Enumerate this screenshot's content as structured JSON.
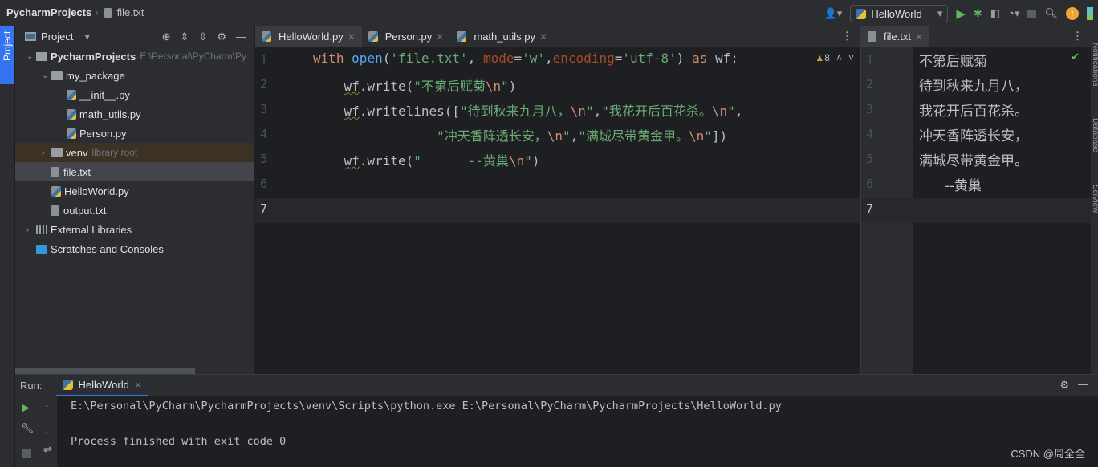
{
  "breadcrumb": {
    "project": "PycharmProjects",
    "file": "file.txt"
  },
  "toolbar": {
    "run_config": "HelloWorld"
  },
  "left_stripe": {
    "project_tab": "Project"
  },
  "project_panel": {
    "title": "Project",
    "items": [
      {
        "label": "PycharmProjects",
        "hint": "E:\\Personal\\PyCharm\\Py",
        "type": "folder",
        "indent": 0,
        "expanded": true
      },
      {
        "label": "my_package",
        "type": "package",
        "indent": 1,
        "expanded": true
      },
      {
        "label": "__init__.py",
        "type": "py",
        "indent": 2
      },
      {
        "label": "math_utils.py",
        "type": "py",
        "indent": 2
      },
      {
        "label": "Person.py",
        "type": "py",
        "indent": 2
      },
      {
        "label": "venv",
        "hint": "library root",
        "type": "folder",
        "indent": 1,
        "expanded": false
      },
      {
        "label": "file.txt",
        "type": "txt",
        "indent": 1,
        "selected": true
      },
      {
        "label": "HelloWorld.py",
        "type": "py",
        "indent": 1
      },
      {
        "label": "output.txt",
        "type": "txt",
        "indent": 1
      },
      {
        "label": "External Libraries",
        "type": "lib",
        "indent": 0,
        "expanded": false
      },
      {
        "label": "Scratches and Consoles",
        "type": "scratch",
        "indent": 0
      }
    ]
  },
  "editor": {
    "tabs": [
      "HelloWorld.py",
      "Person.py",
      "math_utils.py"
    ],
    "active_tab": 0,
    "warnings": "8",
    "line_numbers": [
      "1",
      "2",
      "3",
      "4",
      "5",
      "6",
      "7"
    ],
    "lines": [
      [
        [
          "kw",
          "with "
        ],
        [
          "fn",
          "open"
        ],
        [
          "",
          "("
        ],
        [
          "st",
          "'file.txt'"
        ],
        [
          "",
          ", "
        ],
        [
          "nm",
          "mode"
        ],
        [
          "",
          "="
        ],
        [
          "st",
          "'w'"
        ],
        [
          "",
          ","
        ],
        [
          "nm",
          "encoding"
        ],
        [
          "",
          "="
        ],
        [
          "st",
          "'utf-8'"
        ],
        [
          "",
          ") "
        ],
        [
          "kw",
          "as"
        ],
        [
          "",
          " wf:"
        ]
      ],
      [
        [
          "",
          "    "
        ],
        [
          "wav",
          "wf"
        ],
        [
          "",
          ".write("
        ],
        [
          "st",
          "\"不第后赋菊"
        ],
        [
          "esc",
          "\\n"
        ],
        [
          "st",
          "\""
        ],
        [
          "",
          ")"
        ]
      ],
      [
        [
          "",
          "    "
        ],
        [
          "wav",
          "wf"
        ],
        [
          "",
          ".writelines(["
        ],
        [
          "st",
          "\"待到秋来九月八，"
        ],
        [
          "esc",
          "\\n"
        ],
        [
          "st",
          "\""
        ],
        [
          "",
          ","
        ],
        [
          "st",
          "\"我花开后百花杀。"
        ],
        [
          "esc",
          "\\n"
        ],
        [
          "st",
          "\""
        ],
        [
          "",
          ","
        ]
      ],
      [
        [
          "",
          "                "
        ],
        [
          "st",
          "\"冲天香阵透长安，"
        ],
        [
          "esc",
          "\\n"
        ],
        [
          "st",
          "\""
        ],
        [
          "",
          ","
        ],
        [
          "st",
          "\"满城尽带黄金甲。"
        ],
        [
          "esc",
          "\\n"
        ],
        [
          "st",
          "\""
        ],
        [
          "",
          "])"
        ]
      ],
      [
        [
          "",
          "    "
        ],
        [
          "wav",
          "wf"
        ],
        [
          "",
          ".write("
        ],
        [
          "st",
          "\"      --黄巢"
        ],
        [
          "esc",
          "\\n"
        ],
        [
          "st",
          "\""
        ],
        [
          "",
          ")"
        ]
      ],
      [],
      []
    ]
  },
  "preview": {
    "tab": "file.txt",
    "line_numbers": [
      "1",
      "2",
      "3",
      "4",
      "5",
      "6",
      "7"
    ],
    "lines": [
      "不第后赋菊",
      "待到秋来九月八，",
      "我花开后百花杀。",
      "冲天香阵透长安，",
      "满城尽带黄金甲。",
      "      --黄巢",
      ""
    ]
  },
  "right_stripe": [
    "Notifications",
    "Database",
    "SciView"
  ],
  "run": {
    "label": "Run:",
    "tab": "HelloWorld",
    "output": [
      "E:\\Personal\\PyCharm\\PycharmProjects\\venv\\Scripts\\python.exe E:\\Personal\\PyCharm\\PycharmProjects\\HelloWorld.py",
      "",
      "Process finished with exit code 0"
    ]
  },
  "watermark": "CSDN @周全全",
  "colors": {
    "accent": "#3574f0",
    "run_green": "#5fb85c",
    "keyword": "#cf8e6d",
    "string": "#6aab73",
    "function": "#56a8f5"
  }
}
